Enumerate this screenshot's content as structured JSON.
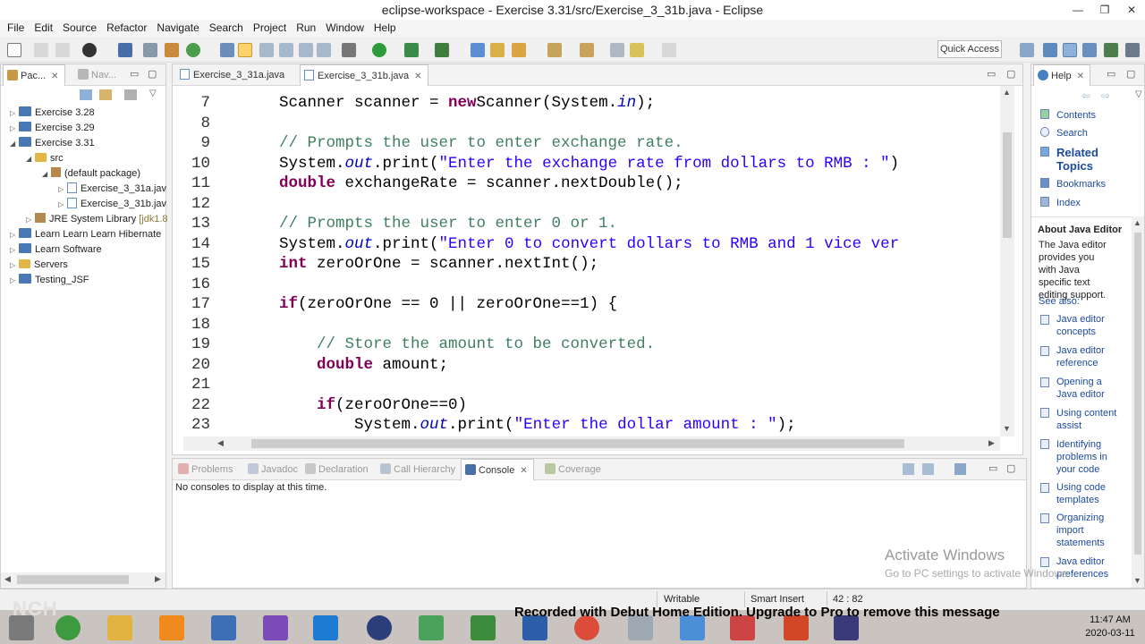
{
  "window": {
    "title": "eclipse-workspace - Exercise 3.31/src/Exercise_3_31b.java - Eclipse",
    "min": "—",
    "max": "❐",
    "close": "✕"
  },
  "menu": [
    "File",
    "Edit",
    "Source",
    "Refactor",
    "Navigate",
    "Search",
    "Project",
    "Run",
    "Window",
    "Help"
  ],
  "toolbar": {
    "quick_access": "Quick Access"
  },
  "explorer": {
    "tabs": {
      "package": "Pac...",
      "navigator": "Nav..."
    },
    "items": {
      "p328": "Exercise 3.28",
      "p329": "Exercise 3.29",
      "p331": "Exercise 3.31",
      "src": "src",
      "default_pkg": "(default package)",
      "file_a": "Exercise_3_31a.jav",
      "file_b": "Exercise_3_31b.jav",
      "jre": "JRE System Library",
      "jre_suffix": "[jdk1.8",
      "hibernate": "Learn Learn Learn Hibernate",
      "software": "Learn Software",
      "servers": "Servers",
      "jsf": "Testing_JSF"
    }
  },
  "editor": {
    "tabs": {
      "a": "Exercise_3_31a.java",
      "b": "Exercise_3_31b.java"
    },
    "lines": [
      {
        "n": "7",
        "segs": [
          [
            "",
            "Scanner scanner = "
          ],
          [
            "kw",
            "new"
          ],
          [
            "",
            "Scanner(System."
          ],
          [
            "fld",
            "in"
          ],
          [
            "",
            ");"
          ]
        ]
      },
      {
        "n": "8",
        "segs": []
      },
      {
        "n": "9",
        "segs": [
          [
            "cm",
            "// Prompts the user to enter exchange rate."
          ]
        ]
      },
      {
        "n": "10",
        "segs": [
          [
            "",
            "System."
          ],
          [
            "fld",
            "out"
          ],
          [
            "",
            ".print("
          ],
          [
            "st",
            "\"Enter the exchange rate from dollars to RMB : \""
          ],
          [
            "",
            ")"
          ]
        ]
      },
      {
        "n": "11",
        "segs": [
          [
            "kw",
            "double"
          ],
          [
            "",
            " exchangeRate = scanner.nextDouble();"
          ]
        ]
      },
      {
        "n": "12",
        "segs": []
      },
      {
        "n": "13",
        "segs": [
          [
            "cm",
            "// Prompts the user to enter 0 or 1."
          ]
        ]
      },
      {
        "n": "14",
        "segs": [
          [
            "",
            "System."
          ],
          [
            "fld",
            "out"
          ],
          [
            "",
            ".print("
          ],
          [
            "st",
            "\"Enter 0 to convert dollars to RMB and 1 vice ver"
          ]
        ]
      },
      {
        "n": "15",
        "segs": [
          [
            "kw",
            "int"
          ],
          [
            "",
            " zeroOrOne = scanner.nextInt();"
          ]
        ]
      },
      {
        "n": "16",
        "segs": []
      },
      {
        "n": "17",
        "segs": [
          [
            "kw",
            "if"
          ],
          [
            "",
            "(zeroOrOne == 0 || zeroOrOne==1) {"
          ]
        ]
      },
      {
        "n": "18",
        "segs": []
      },
      {
        "n": "19",
        "segs": [
          [
            "",
            "    "
          ],
          [
            "cm",
            "// Store the amount to be converted."
          ]
        ]
      },
      {
        "n": "20",
        "segs": [
          [
            "",
            "    "
          ],
          [
            "kw",
            "double"
          ],
          [
            "",
            " amount;"
          ]
        ]
      },
      {
        "n": "21",
        "segs": []
      },
      {
        "n": "22",
        "segs": [
          [
            "",
            "    "
          ],
          [
            "kw",
            "if"
          ],
          [
            "",
            "(zeroOrOne==0)"
          ]
        ]
      },
      {
        "n": "23",
        "segs": [
          [
            "",
            "        System."
          ],
          [
            "fld",
            "out"
          ],
          [
            "",
            ".print("
          ],
          [
            "st",
            "\"Enter the dollar amount : \""
          ],
          [
            "",
            ");"
          ]
        ]
      }
    ]
  },
  "bottom": {
    "tabs": {
      "problems": "Problems",
      "javadoc": "Javadoc",
      "declaration": "Declaration",
      "hierarchy": "Call Hierarchy",
      "console": "Console",
      "coverage": "Coverage"
    },
    "message": "No consoles to display at this time."
  },
  "help": {
    "tab": "Help",
    "links": {
      "contents": "Contents",
      "search": "Search",
      "related": "Related Topics",
      "bookmarks": "Bookmarks",
      "index": "Index"
    },
    "about_title": "About Java Editor",
    "about_text": "The Java editor provides you with Java specific text editing support.",
    "see_also": "See also:",
    "topics": [
      "Java editor concepts",
      "Java editor reference",
      "Opening a Java editor",
      "Using content assist",
      "Identifying problems in your code",
      "Using code templates",
      "Organizing import statements",
      "Java editor preferences"
    ]
  },
  "status": {
    "writable": "Writable",
    "insert": "Smart Insert",
    "position": "42 : 82"
  },
  "watermark": {
    "line1": "Activate Windows",
    "line2": "Go to PC settings to activate Windows.",
    "recorded": "Recorded with Debut Home Edition. Upgrade to Pro to remove this message",
    "nch": "NCH"
  },
  "clock": {
    "time": "11:47 AM",
    "date": "2020-03-11"
  },
  "colors": {
    "keyword": "#7f0055",
    "comment": "#3f7f5f",
    "string": "#2a00ff",
    "field": "#0000c0",
    "accent": "#1e7fd6"
  }
}
